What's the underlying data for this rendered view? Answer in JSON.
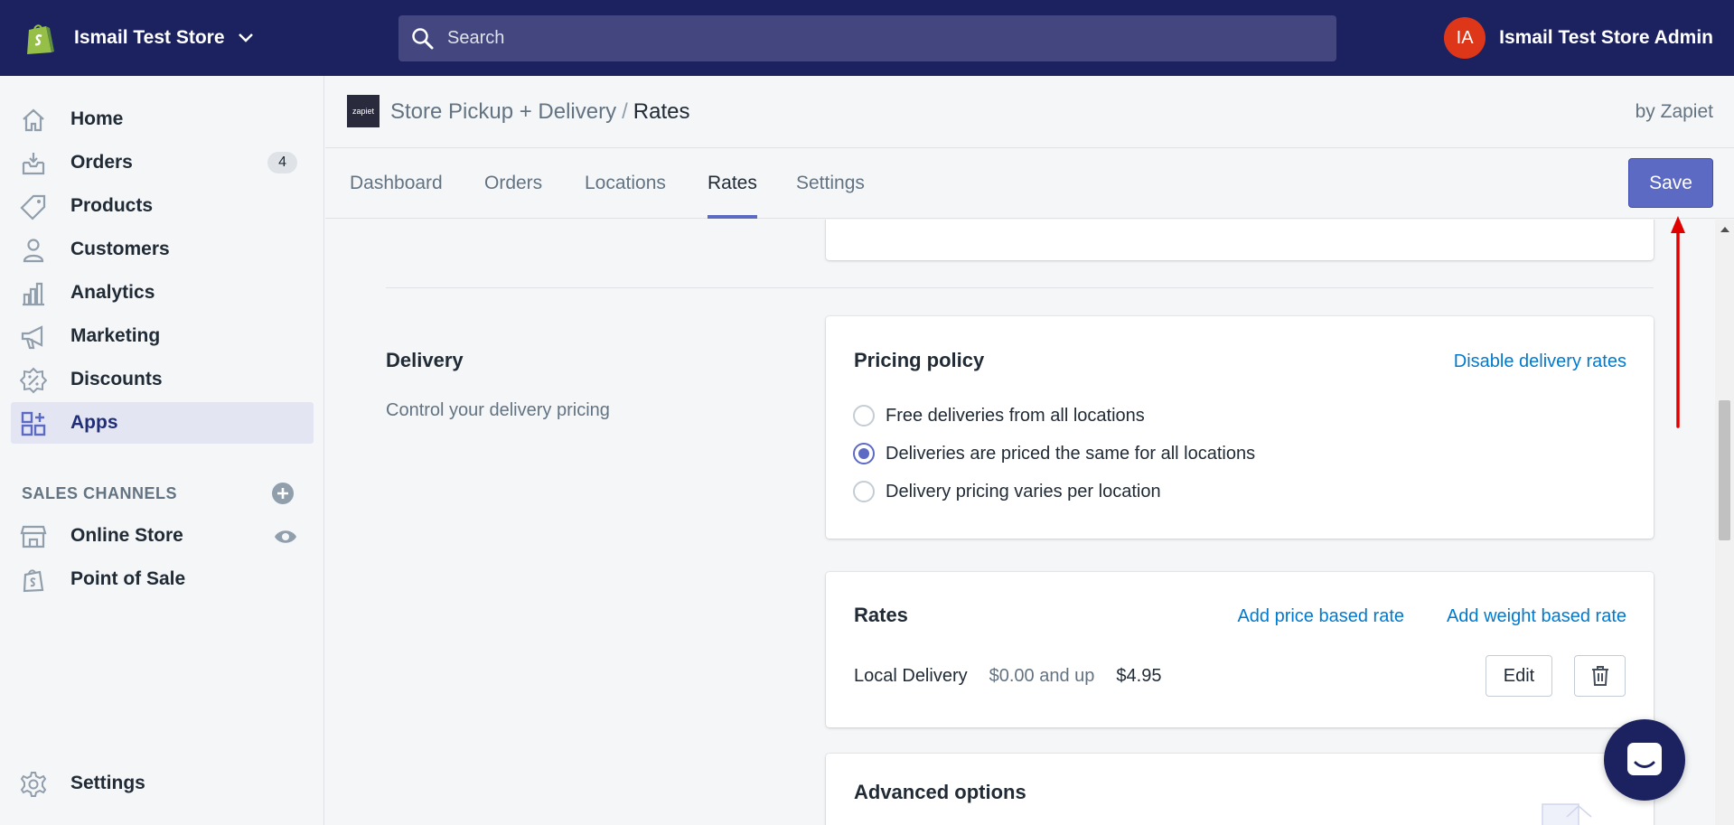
{
  "topbar": {
    "store_name": "Ismail Test Store",
    "search_placeholder": "Search",
    "avatar_initials": "IA",
    "user_name": "Ismail Test Store Admin"
  },
  "sidebar": {
    "items": [
      {
        "label": "Home",
        "icon": "home-icon"
      },
      {
        "label": "Orders",
        "icon": "orders-icon",
        "badge": "4"
      },
      {
        "label": "Products",
        "icon": "tag-icon"
      },
      {
        "label": "Customers",
        "icon": "person-icon"
      },
      {
        "label": "Analytics",
        "icon": "bar-chart-icon"
      },
      {
        "label": "Marketing",
        "icon": "megaphone-icon"
      },
      {
        "label": "Discounts",
        "icon": "discount-icon"
      },
      {
        "label": "Apps",
        "icon": "apps-icon",
        "active": true
      }
    ],
    "sales_channels_title": "SALES CHANNELS",
    "channels": [
      {
        "label": "Online Store",
        "icon": "store-icon"
      },
      {
        "label": "Point of Sale",
        "icon": "pos-icon"
      }
    ],
    "settings_label": "Settings"
  },
  "app_header": {
    "logo_text": "zapiet",
    "breadcrumb_parent": "Store Pickup + Delivery",
    "breadcrumb_sep": "/",
    "breadcrumb_current": "Rates",
    "by_label": "by Zapiet"
  },
  "tabs": {
    "items": [
      "Dashboard",
      "Orders",
      "Locations",
      "Rates",
      "Settings"
    ],
    "active": "Rates",
    "save_label": "Save"
  },
  "delivery": {
    "section_title": "Delivery",
    "section_desc": "Control your delivery pricing",
    "pricing_policy": {
      "title": "Pricing policy",
      "disable_link": "Disable delivery rates",
      "options": [
        {
          "label": "Free deliveries from all locations",
          "checked": false
        },
        {
          "label": "Deliveries are priced the same for all locations",
          "checked": true
        },
        {
          "label": "Delivery pricing varies per location",
          "checked": false
        }
      ]
    },
    "rates": {
      "title": "Rates",
      "add_price_link": "Add price based rate",
      "add_weight_link": "Add weight based rate",
      "row": {
        "name": "Local Delivery",
        "condition": "$0.00 and up",
        "price": "$4.95",
        "edit_label": "Edit"
      }
    },
    "advanced": {
      "title": "Advanced options"
    }
  },
  "colors": {
    "topbar": "#1c2260",
    "accent": "#5c6ac4",
    "link": "#007ace",
    "annotation": "#e00000"
  }
}
